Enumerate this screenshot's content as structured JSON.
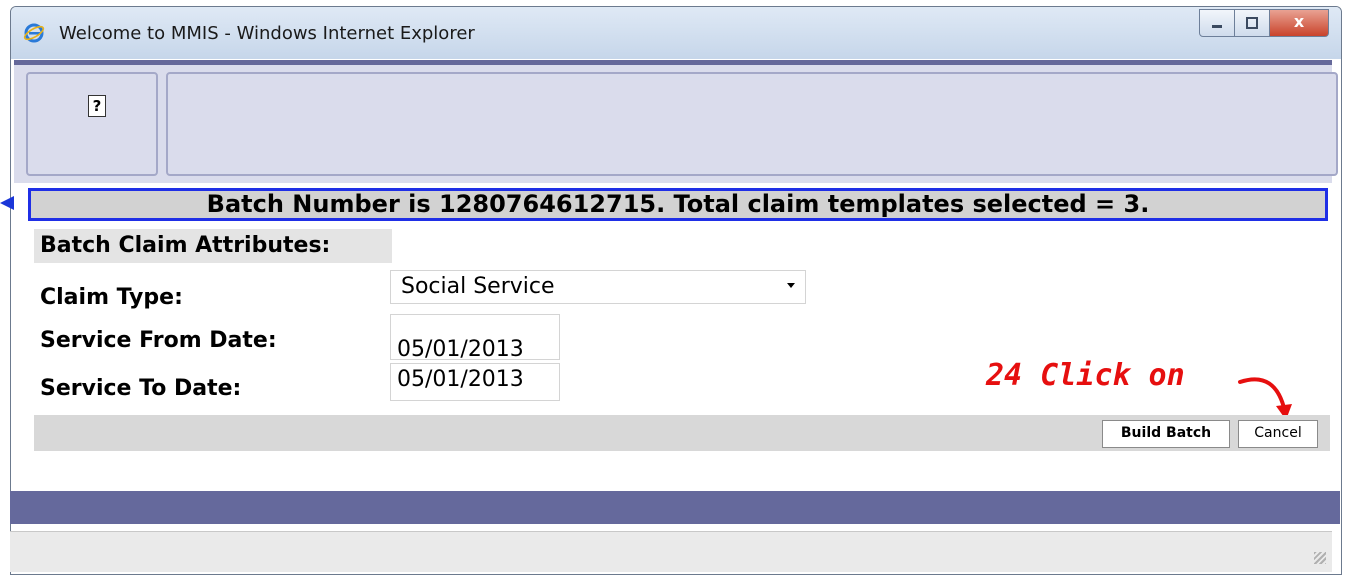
{
  "window": {
    "title": "Welcome to MMIS - Windows Internet Explorer",
    "close_label": "x"
  },
  "help": {
    "label": "?"
  },
  "banner": {
    "text": "Batch Number is 1280764612715. Total claim templates selected = 3."
  },
  "form": {
    "section_title": "Batch Claim Attributes:",
    "claim_type_label": "Claim Type:",
    "claim_type_value": "Social Service",
    "from_label": "Service From Date:",
    "from_value": "05/01/2013",
    "to_label": "Service To Date:",
    "to_value": "05/01/2013"
  },
  "annotation": {
    "text": "24 Click on"
  },
  "buttons": {
    "build_batch": "Build Batch",
    "cancel": "Cancel"
  },
  "colors": {
    "banner_border": "#1f2fe6",
    "annotation": "#e60f0f",
    "band": "#65699c"
  }
}
